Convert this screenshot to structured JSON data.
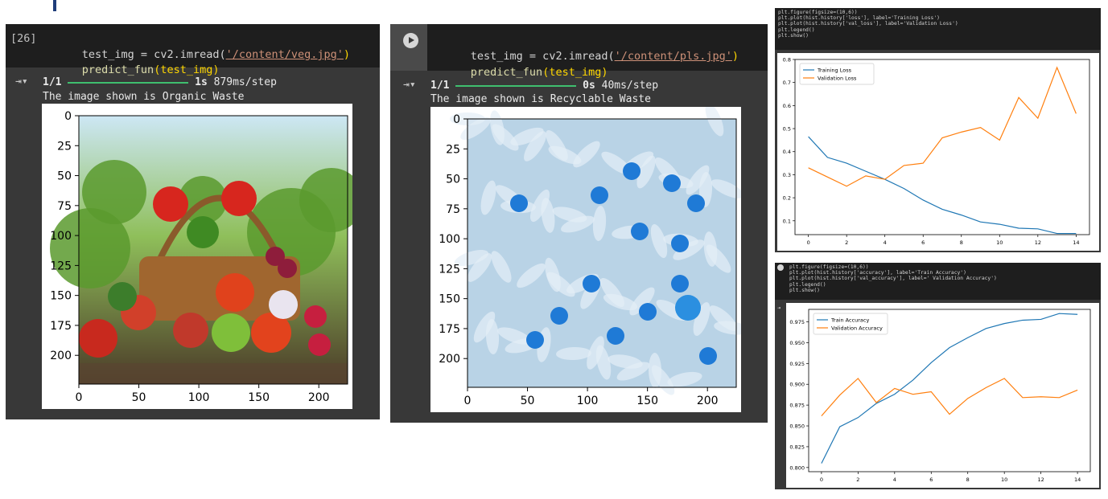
{
  "cells": [
    {
      "exec_count": "[26]",
      "code_line1": {
        "var": "test_img = cv2.imread(",
        "path": "'/content/veg.jpg'",
        "close": ")"
      },
      "code_line2": {
        "fn": "predict_fun",
        "arg": "(test_img)"
      },
      "progress": {
        "count": "1/1",
        "time_bold": "1s",
        "time": "879ms/step"
      },
      "message": "The image shown is Organic Waste",
      "x_ticks": [
        "0",
        "50",
        "100",
        "150",
        "200"
      ],
      "y_ticks": [
        "0",
        "25",
        "50",
        "75",
        "100",
        "125",
        "150",
        "175",
        "200"
      ],
      "image_desc": "vegetable-basket-photo"
    },
    {
      "code_line1": {
        "var": "test_img = cv2.imread(",
        "path": "'/content/pls.jpg'",
        "close": ")"
      },
      "code_line2": {
        "fn": "predict_fun",
        "arg": "(test_img)"
      },
      "progress": {
        "count": "1/1",
        "time_bold": "0s",
        "time": "40ms/step"
      },
      "message": "The image shown is Recyclable Waste",
      "x_ticks": [
        "0",
        "50",
        "100",
        "150",
        "200"
      ],
      "y_ticks": [
        "0",
        "25",
        "50",
        "75",
        "100",
        "125",
        "150",
        "175",
        "200"
      ],
      "image_desc": "plastic-bottles-photo"
    }
  ],
  "loss_panel": {
    "code": [
      "plt.figure(figsize=(10,6))",
      "plt.plot(hist.history['loss'], label='Training Loss')",
      "plt.plot(hist.history['val_loss'], label='Validation Loss')",
      "plt.legend()",
      "plt.show()"
    ]
  },
  "acc_panel": {
    "code": [
      "plt.figure(figsize=(10,6))",
      "plt.plot(hist.history['accuracy'], label='Train Accuracy')",
      "plt.plot(hist.history['val_accuracy'], label=' Validation Accuracy')",
      "plt.legend()",
      "plt.show()"
    ]
  },
  "chart_data": [
    {
      "type": "line",
      "x": [
        0,
        1,
        2,
        3,
        4,
        5,
        6,
        7,
        8,
        9,
        10,
        11,
        12,
        13,
        14
      ],
      "xlim": [
        -0.7,
        14.7
      ],
      "ylim": [
        0.04,
        0.8
      ],
      "x_ticks": [
        0,
        2,
        4,
        6,
        8,
        10,
        12,
        14
      ],
      "y_ticks": [
        0.1,
        0.2,
        0.3,
        0.4,
        0.5,
        0.6,
        0.7,
        0.8
      ],
      "y_tick_labels": [
        "0.1",
        "0.2",
        "0.3",
        "0.4",
        "0.5",
        "0.6",
        "0.7",
        "0.8"
      ],
      "legend_loc": "upper-left",
      "series": [
        {
          "name": "Training Loss",
          "color": "#1f77b4",
          "values": [
            0.465,
            0.375,
            0.35,
            0.315,
            0.28,
            0.24,
            0.19,
            0.15,
            0.125,
            0.095,
            0.085,
            0.068,
            0.065,
            0.045,
            0.045
          ]
        },
        {
          "name": "Validation Loss",
          "color": "#ff7f0e",
          "values": [
            0.33,
            0.29,
            0.25,
            0.295,
            0.28,
            0.34,
            0.35,
            0.46,
            0.485,
            0.505,
            0.45,
            0.635,
            0.545,
            0.765,
            0.565
          ]
        }
      ]
    },
    {
      "type": "line",
      "x": [
        0,
        1,
        2,
        3,
        4,
        5,
        6,
        7,
        8,
        9,
        10,
        11,
        12,
        13,
        14
      ],
      "xlim": [
        -0.7,
        14.7
      ],
      "ylim": [
        0.795,
        0.99
      ],
      "x_ticks": [
        0,
        2,
        4,
        6,
        8,
        10,
        12,
        14
      ],
      "y_ticks": [
        0.8,
        0.825,
        0.85,
        0.875,
        0.9,
        0.925,
        0.95,
        0.975
      ],
      "y_tick_labels": [
        "0.800",
        "0.825",
        "0.850",
        "0.875",
        "0.900",
        "0.925",
        "0.950",
        "0.975"
      ],
      "legend_loc": "upper-left",
      "series": [
        {
          "name": "Train Accuracy",
          "color": "#1f77b4",
          "values": [
            0.805,
            0.849,
            0.86,
            0.877,
            0.888,
            0.905,
            0.926,
            0.944,
            0.956,
            0.967,
            0.973,
            0.977,
            0.978,
            0.985,
            0.984
          ]
        },
        {
          "name": "Validation Accuracy",
          "color": "#ff7f0e",
          "values": [
            0.862,
            0.887,
            0.907,
            0.878,
            0.895,
            0.888,
            0.891,
            0.864,
            0.883,
            0.896,
            0.907,
            0.884,
            0.885,
            0.884,
            0.893
          ]
        }
      ]
    }
  ]
}
